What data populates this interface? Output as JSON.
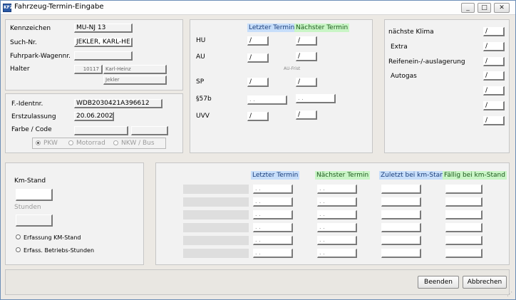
{
  "window": {
    "title": "Fahrzeug-Termin-Eingabe",
    "icon_label": "KFZ",
    "minimize_glyph": "_",
    "maximize_glyph": "□",
    "close_glyph": "✕"
  },
  "vehicle": {
    "kennzeichen_label": "Kennzeichen",
    "kennzeichen_value": "MÜ-NJ 13",
    "suchnr_label": "Such-Nr.",
    "suchnr_value": "JEKLER, KARL-HE",
    "fuhrpark_label": "Fuhrpark-Wagennr.",
    "fuhrpark_value": "",
    "halter_label": "Halter",
    "halter_nr": "10117",
    "halter_vorname": "Karl-Heinz",
    "halter_name": "Jekler"
  },
  "ident": {
    "fident_label": "F.-Identnr.",
    "fident_value": "WDB2030421A396612",
    "erstzulassung_label": "Erstzulassung",
    "erstzulassung_value": "20.06.2002",
    "farbe_label": "Farbe / Code",
    "farbe_value": "",
    "code_value": "",
    "types": [
      "PKW",
      "Motorrad",
      "NKW / Bus"
    ],
    "selected_type": "PKW"
  },
  "termine": {
    "header_last": "Letzter Termin",
    "header_next": "Nächster Termin",
    "au_frist_label": "AU-Frist",
    "rows": [
      {
        "label": "HU",
        "last": "/",
        "next": "/"
      },
      {
        "label": "AU",
        "last": "/",
        "next": "/"
      },
      {
        "label": "SP",
        "last": "/",
        "next": "/"
      },
      {
        "label": "§57b",
        "last": ". .",
        "next": ". ."
      },
      {
        "label": "UVV",
        "last": "/",
        "next": "/"
      }
    ]
  },
  "klima": {
    "rows": [
      {
        "label": "nächste Klima",
        "value": "/"
      },
      {
        "label": "Extra",
        "value": "/"
      },
      {
        "label": "Reifenein-/-auslagerung",
        "value": "/"
      },
      {
        "label": "Autogas",
        "value": "/"
      },
      {
        "label": "",
        "value": "/"
      },
      {
        "label": "",
        "value": "/"
      },
      {
        "label": "",
        "value": "/"
      }
    ]
  },
  "km": {
    "kmstand_label": "Km-Stand",
    "kmstand_value": "",
    "stunden_label": "Stunden",
    "stunden_value": "",
    "radio_km": "Erfassung KM-Stand",
    "radio_stunden": "Erfass. Betriebs-Stunden"
  },
  "km_table": {
    "headers": [
      "Letzter Termin",
      "Nächster Termin",
      "Zuletzt bei km-Stand",
      "Fällig bei km-Stand"
    ],
    "rows": [
      {
        "last": ". .",
        "next": ". .",
        "zuletzt": "",
        "faellig": ""
      },
      {
        "last": ". .",
        "next": ". .",
        "zuletzt": "",
        "faellig": ""
      },
      {
        "last": ". .",
        "next": ". .",
        "zuletzt": "",
        "faellig": ""
      },
      {
        "last": ". .",
        "next": ". .",
        "zuletzt": "",
        "faellig": ""
      },
      {
        "last": ". .",
        "next": ". .",
        "zuletzt": "",
        "faellig": ""
      },
      {
        "last": ". .",
        "next": ". .",
        "zuletzt": "",
        "faellig": ""
      }
    ]
  },
  "buttons": {
    "beenden": "Beenden",
    "abbrechen": "Abbrechen"
  }
}
